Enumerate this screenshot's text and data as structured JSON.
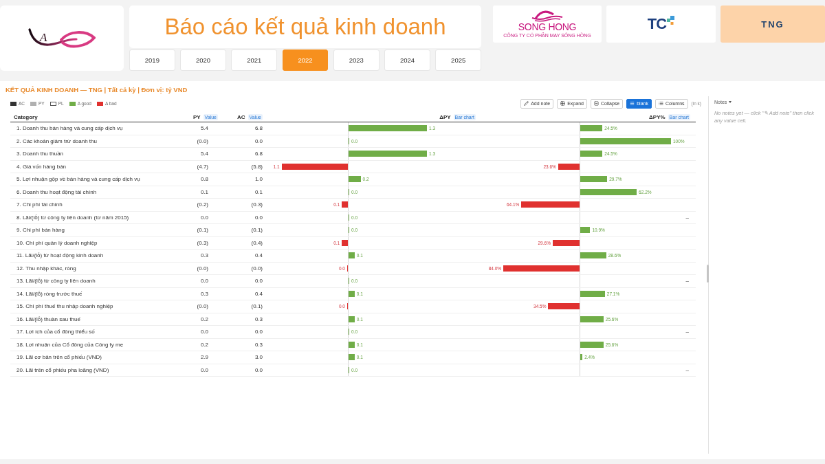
{
  "header": {
    "brand_logo": {
      "mark": "A"
    },
    "title": "Báo cáo kết quả kinh doanh",
    "years": [
      {
        "label": "2019",
        "selected": false
      },
      {
        "label": "2020",
        "selected": false
      },
      {
        "label": "2021",
        "selected": false
      },
      {
        "label": "2022",
        "selected": true
      },
      {
        "label": "2023",
        "selected": false
      },
      {
        "label": "2024",
        "selected": false
      },
      {
        "label": "2025",
        "selected": false
      }
    ],
    "companies": [
      {
        "kind": "wave",
        "name": "SONG HONG",
        "tagline": "CÔNG TY CỔ PHẦN MAY SÔNG HỒNG",
        "selected": false
      },
      {
        "kind": "squares",
        "name": "TC",
        "selected": false
      },
      {
        "kind": "plain",
        "name": "TNG",
        "selected": true
      }
    ]
  },
  "report": {
    "title": "KẾT QUẢ KINH DOANH — TNG | Tất cả kỳ | Đơn vị: tỷ VND",
    "legend": [
      {
        "label": "AC",
        "kind": "solid",
        "color": "#333333"
      },
      {
        "label": "PY",
        "kind": "solid",
        "color": "#b0b0b0"
      },
      {
        "label": "PL",
        "kind": "outline",
        "color": "#555555"
      },
      {
        "label": "Δ good",
        "kind": "solid",
        "color": "#70ad47"
      },
      {
        "label": "Δ bad",
        "kind": "solid",
        "color": "#e0312f"
      }
    ],
    "toolbar": {
      "buttons": [
        {
          "kind": "pencil",
          "label": "Add note",
          "on": false
        },
        {
          "kind": "grid",
          "label": "Expand",
          "on": false
        },
        {
          "kind": "minus",
          "label": "Collapse",
          "on": false
        },
        {
          "kind": "lines",
          "label": "blank",
          "on": true
        },
        {
          "kind": "list",
          "label": "Columns",
          "on": false
        }
      ],
      "unit_note": "(in k)"
    },
    "table": {
      "columns": [
        {
          "label": "Category"
        },
        {
          "label": "PY",
          "badge": "Value"
        },
        {
          "label": "AC",
          "badge": "Value"
        },
        {
          "label": "ΔPY",
          "badge": "Bar chart"
        },
        {
          "label": "ΔPY%",
          "badge": "Bar chart"
        }
      ],
      "rows": [
        {
          "category": "1. Doanh thu bán hàng và cung cấp dịch vụ",
          "py": "5.4",
          "ac": "6.8",
          "delta": {
            "kind": "good",
            "label": "1.3"
          },
          "delta_pct": {
            "kind": "good",
            "label": "24.5%"
          }
        },
        {
          "category": "2. Các khoản giảm trừ doanh thu",
          "py": "(0.0)",
          "ac": "0.0",
          "delta": {
            "kind": "good",
            "label": "0.0"
          },
          "delta_pct": {
            "kind": "good",
            "label": "100%"
          }
        },
        {
          "category": "3. Doanh thu thuần",
          "py": "5.4",
          "ac": "6.8",
          "delta": {
            "kind": "good",
            "label": "1.3"
          },
          "delta_pct": {
            "kind": "good",
            "label": "24.5%"
          }
        },
        {
          "category": "4. Giá vốn hàng bán",
          "py": "(4.7)",
          "ac": "(5.8)",
          "delta": {
            "kind": "bad",
            "label": "1.1"
          },
          "delta_pct": {
            "kind": "bad",
            "label": "23.6%"
          }
        },
        {
          "category": "5. Lợi nhuận gộp về bán hàng và cung cấp dịch vụ",
          "py": "0.8",
          "ac": "1.0",
          "delta": {
            "kind": "good",
            "label": "0.2"
          },
          "delta_pct": {
            "kind": "good",
            "label": "29.7%"
          }
        },
        {
          "category": "6. Doanh thu hoạt động tài chính",
          "py": "0.1",
          "ac": "0.1",
          "delta": {
            "kind": "good",
            "label": "0.0"
          },
          "delta_pct": {
            "kind": "good",
            "label": "62.2%"
          }
        },
        {
          "category": "7. Chi phí tài chính",
          "py": "(0.2)",
          "ac": "(0.3)",
          "delta": {
            "kind": "bad",
            "label": "0.1"
          },
          "delta_pct": {
            "kind": "bad",
            "label": "64.1%"
          }
        },
        {
          "category": "8. Lãi/(lỗ) từ công ty liên doanh (từ năm 2015)",
          "py": "0.0",
          "ac": "0.0",
          "delta": {
            "kind": "good",
            "label": "0.0"
          },
          "delta_pct": {
            "kind": "none",
            "label": "–"
          }
        },
        {
          "category": "9. Chi phí bán hàng",
          "py": "(0.1)",
          "ac": "(0.1)",
          "delta": {
            "kind": "good",
            "label": "0.0"
          },
          "delta_pct": {
            "kind": "good",
            "label": "10.9%"
          }
        },
        {
          "category": "10. Chi phí quản lý doanh nghiệp",
          "py": "(0.3)",
          "ac": "(0.4)",
          "delta": {
            "kind": "bad",
            "label": "0.1"
          },
          "delta_pct": {
            "kind": "bad",
            "label": "29.6%"
          }
        },
        {
          "category": "11. Lãi/(lỗ) từ hoạt động kinh doanh",
          "py": "0.3",
          "ac": "0.4",
          "delta": {
            "kind": "good",
            "label": "0.1"
          },
          "delta_pct": {
            "kind": "good",
            "label": "28.6%"
          }
        },
        {
          "category": "12. Thu nhập khác, ròng",
          "py": "(0.0)",
          "ac": "(0.0)",
          "delta": {
            "kind": "bad",
            "label": "0.0"
          },
          "delta_pct": {
            "kind": "bad",
            "label": "84.0%"
          }
        },
        {
          "category": "13. Lãi/(lỗ) từ công ty liên doanh",
          "py": "0.0",
          "ac": "0.0",
          "delta": {
            "kind": "good",
            "label": "0.0"
          },
          "delta_pct": {
            "kind": "none",
            "label": "–"
          }
        },
        {
          "category": "14. Lãi/(lỗ) ròng trước thuế",
          "py": "0.3",
          "ac": "0.4",
          "delta": {
            "kind": "good",
            "label": "0.1"
          },
          "delta_pct": {
            "kind": "good",
            "label": "27.1%"
          }
        },
        {
          "category": "15. Chi phí thuế thu nhập doanh nghiệp",
          "py": "(0.0)",
          "ac": "(0.1)",
          "delta": {
            "kind": "bad",
            "label": "0.0"
          },
          "delta_pct": {
            "kind": "bad",
            "label": "34.5%"
          }
        },
        {
          "category": "16. Lãi/(lỗ) thuần sau thuế",
          "py": "0.2",
          "ac": "0.3",
          "delta": {
            "kind": "good",
            "label": "0.1"
          },
          "delta_pct": {
            "kind": "good",
            "label": "25.6%"
          }
        },
        {
          "category": "17. Lợi ích của cổ đông thiểu số",
          "py": "0.0",
          "ac": "0.0",
          "delta": {
            "kind": "good",
            "label": "0.0"
          },
          "delta_pct": {
            "kind": "none",
            "label": "–"
          }
        },
        {
          "category": "18. Lợi nhuận của Cổ đông của Công ty mẹ",
          "py": "0.2",
          "ac": "0.3",
          "delta": {
            "kind": "good",
            "label": "0.1"
          },
          "delta_pct": {
            "kind": "good",
            "label": "25.6%"
          }
        },
        {
          "category": "19. Lãi cơ bản trên cổ phiếu (VND)",
          "py": "2.9",
          "ac": "3.0",
          "delta": {
            "kind": "good",
            "label": "0.1"
          },
          "delta_pct": {
            "kind": "good",
            "label": "2.4%"
          }
        },
        {
          "category": "20. Lãi trên cổ phiếu pha loãng (VND)",
          "py": "0.0",
          "ac": "0.0",
          "delta": {
            "kind": "good",
            "label": "0.0"
          },
          "delta_pct": {
            "kind": "none",
            "label": "–"
          }
        }
      ]
    }
  },
  "notes": {
    "title": "Notes",
    "empty_text": "No notes yet — click \"✎ Add note\" then click any value cell."
  }
}
